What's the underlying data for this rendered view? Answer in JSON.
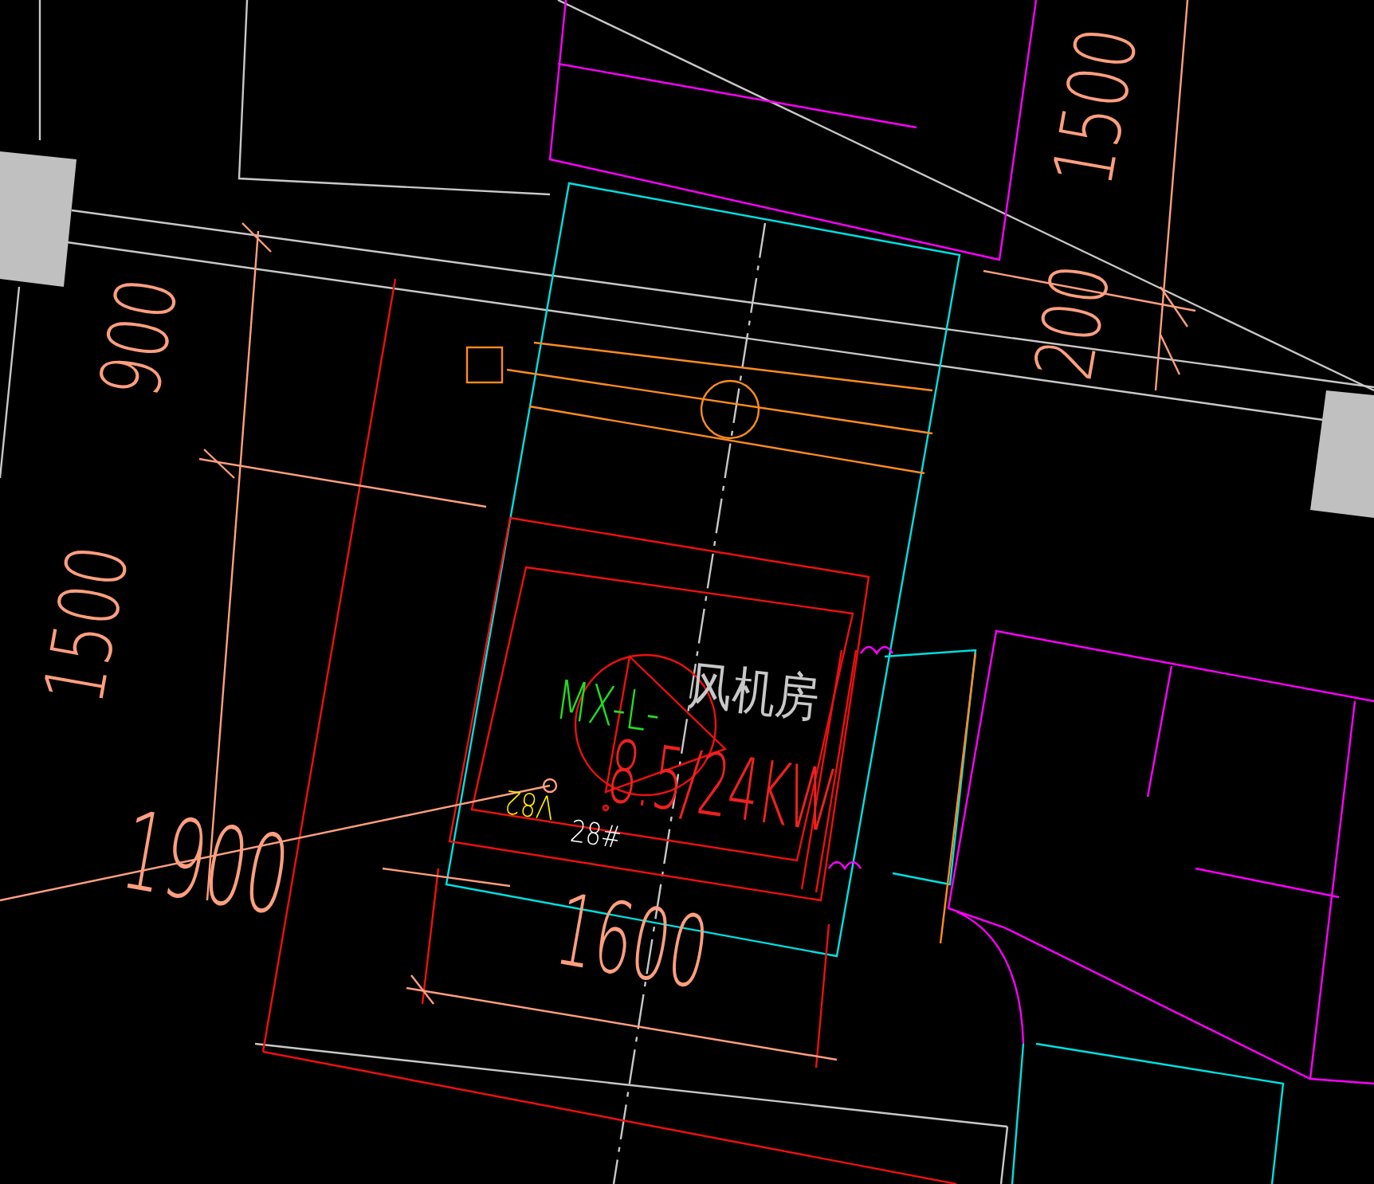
{
  "drawing_canvas": {
    "labels": [
      {
        "text": "1500",
        "kind": "dimension"
      },
      {
        "text": "200",
        "kind": "dimension"
      },
      {
        "text": "900",
        "kind": "dimension"
      },
      {
        "text": "1500",
        "kind": "dimension"
      },
      {
        "text": "风机房",
        "kind": "room"
      },
      {
        "text": "MX-L-",
        "kind": "equipment"
      },
      {
        "text": "8.5/24KW",
        "kind": "power"
      },
      {
        "text": "V82",
        "kind": "tag"
      },
      {
        "text": "28#",
        "kind": "number"
      },
      {
        "text": "1900",
        "kind": "dimension"
      },
      {
        "text": "1600",
        "kind": "dimension"
      }
    ]
  }
}
